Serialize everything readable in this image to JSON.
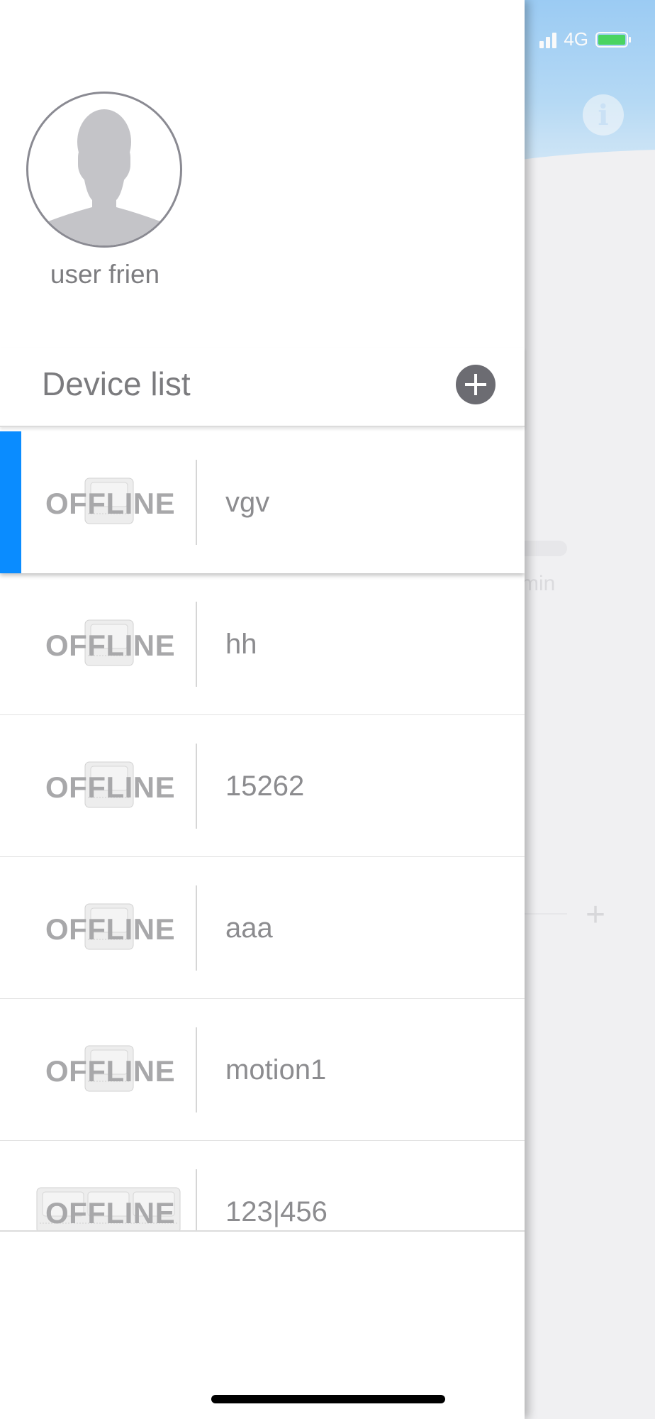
{
  "status_bar": {
    "network": "4G"
  },
  "background": {
    "min_label": "min",
    "plus_label": "+"
  },
  "drawer": {
    "username": "user frien",
    "device_list_title": "Device list",
    "devices": [
      {
        "status": "OFFLINE",
        "name": "vgv",
        "selected": true
      },
      {
        "status": "OFFLINE",
        "name": "hh",
        "selected": false
      },
      {
        "status": "OFFLINE",
        "name": "15262",
        "selected": false
      },
      {
        "status": "OFFLINE",
        "name": "aaa",
        "selected": false
      },
      {
        "status": "OFFLINE",
        "name": "motion1",
        "selected": false
      },
      {
        "status": "OFFLINE",
        "name": "123|456",
        "selected": false
      }
    ]
  },
  "colors": {
    "selection_accent": "#0a8cff",
    "header_blue": "#9fd0f8",
    "battery_green": "#4cd964"
  },
  "icons": {
    "avatar": "user-silhouette-icon",
    "add": "plus-circle-icon",
    "info": "info-icon",
    "device": "recliner-sofa-icon"
  }
}
